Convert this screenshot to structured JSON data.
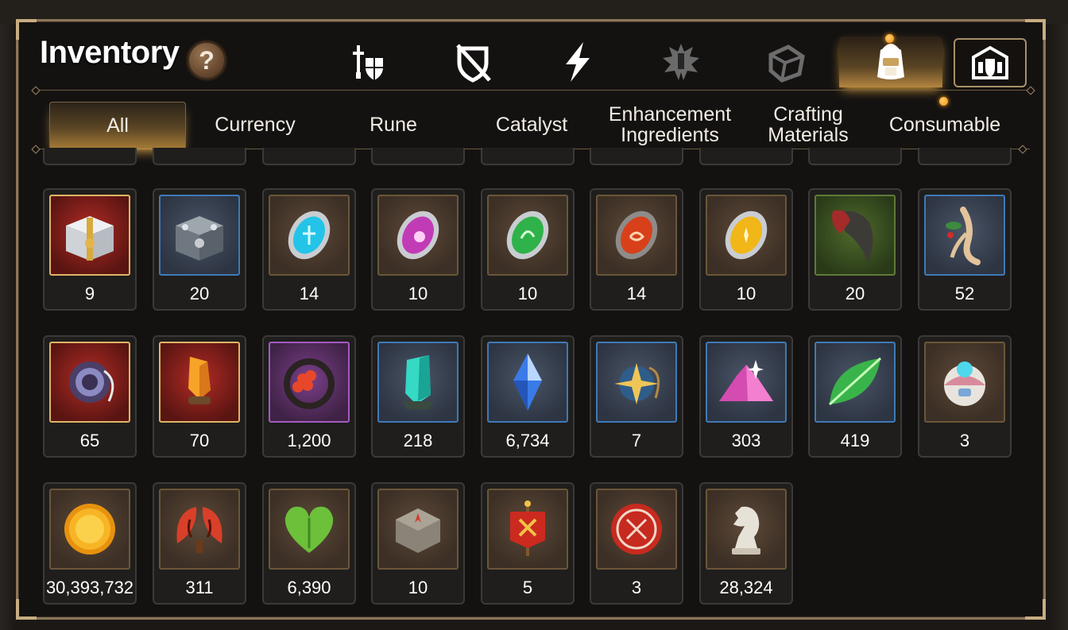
{
  "header": {
    "title": "Inventory",
    "help_label": "?"
  },
  "category_tabs": [
    {
      "name": "tab-hero-gear",
      "icon": "sword-shield-icon"
    },
    {
      "name": "tab-no-equip",
      "icon": "crossed-shield-icon"
    },
    {
      "name": "tab-skill",
      "icon": "lightning-icon"
    },
    {
      "name": "tab-artifact",
      "icon": "spiked-crest-icon"
    },
    {
      "name": "tab-dice",
      "icon": "dice-icon"
    },
    {
      "name": "tab-bag",
      "icon": "backpack-icon",
      "active": true,
      "notification": true
    },
    {
      "name": "tab-guild",
      "icon": "castle-shield-icon"
    }
  ],
  "sub_tabs": [
    {
      "label": "All",
      "active": true
    },
    {
      "label": "Currency"
    },
    {
      "label": "Rune"
    },
    {
      "label": "Catalyst"
    },
    {
      "label": "Enhancement\nIngredients"
    },
    {
      "label": "Crafting\nMaterials"
    },
    {
      "label": "Consumable",
      "notification": true
    }
  ],
  "items": [
    {
      "icon": "gold-chest-icon",
      "rarity": "legend",
      "qty": "9"
    },
    {
      "icon": "silver-chest-icon",
      "rarity": "rare",
      "qty": "20"
    },
    {
      "icon": "blue-rune-icon",
      "rarity": "common",
      "qty": "14"
    },
    {
      "icon": "purple-rune-icon",
      "rarity": "common",
      "qty": "10"
    },
    {
      "icon": "green-rune-icon",
      "rarity": "common",
      "qty": "10"
    },
    {
      "icon": "red-rune-icon",
      "rarity": "common",
      "qty": "14"
    },
    {
      "icon": "yellow-rune-icon",
      "rarity": "common",
      "qty": "10"
    },
    {
      "icon": "beast-claw-icon",
      "rarity": "nature",
      "qty": "20"
    },
    {
      "icon": "ginseng-root-icon",
      "rarity": "rare",
      "qty": "52"
    },
    {
      "icon": "amulet-icon",
      "rarity": "legend",
      "qty": "65"
    },
    {
      "icon": "amber-crystal-icon",
      "rarity": "legend",
      "qty": "70"
    },
    {
      "icon": "flower-ring-icon",
      "rarity": "epic",
      "qty": "1,200"
    },
    {
      "icon": "teal-crystal-icon",
      "rarity": "rare",
      "qty": "218"
    },
    {
      "icon": "blue-gem-icon",
      "rarity": "rare",
      "qty": "6,734"
    },
    {
      "icon": "star-pendant-icon",
      "rarity": "rare",
      "qty": "7"
    },
    {
      "icon": "pink-crystal-pile-icon",
      "rarity": "rare",
      "qty": "303"
    },
    {
      "icon": "glowing-leaf-icon",
      "rarity": "rare",
      "qty": "419"
    },
    {
      "icon": "robot-egg-icon",
      "rarity": "common",
      "qty": "3"
    },
    {
      "icon": "gold-coin-icon",
      "rarity": "common",
      "qty": "30,393,732"
    },
    {
      "icon": "red-leaves-icon",
      "rarity": "common",
      "qty": "311"
    },
    {
      "icon": "green-heart-icon",
      "rarity": "common",
      "qty": "6,390"
    },
    {
      "icon": "stone-compass-icon",
      "rarity": "common",
      "qty": "10"
    },
    {
      "icon": "war-banner-icon",
      "rarity": "common",
      "qty": "5"
    },
    {
      "icon": "red-seal-icon",
      "rarity": "common",
      "qty": "3"
    },
    {
      "icon": "knight-piece-icon",
      "rarity": "common",
      "qty": "28,324"
    }
  ],
  "colors": {
    "panel_border": "#8b7658",
    "active_glow": "#f0b040",
    "rare_border": "#3f79b8",
    "epic_border": "#a25bc1",
    "legend_border": "#e0b464"
  }
}
